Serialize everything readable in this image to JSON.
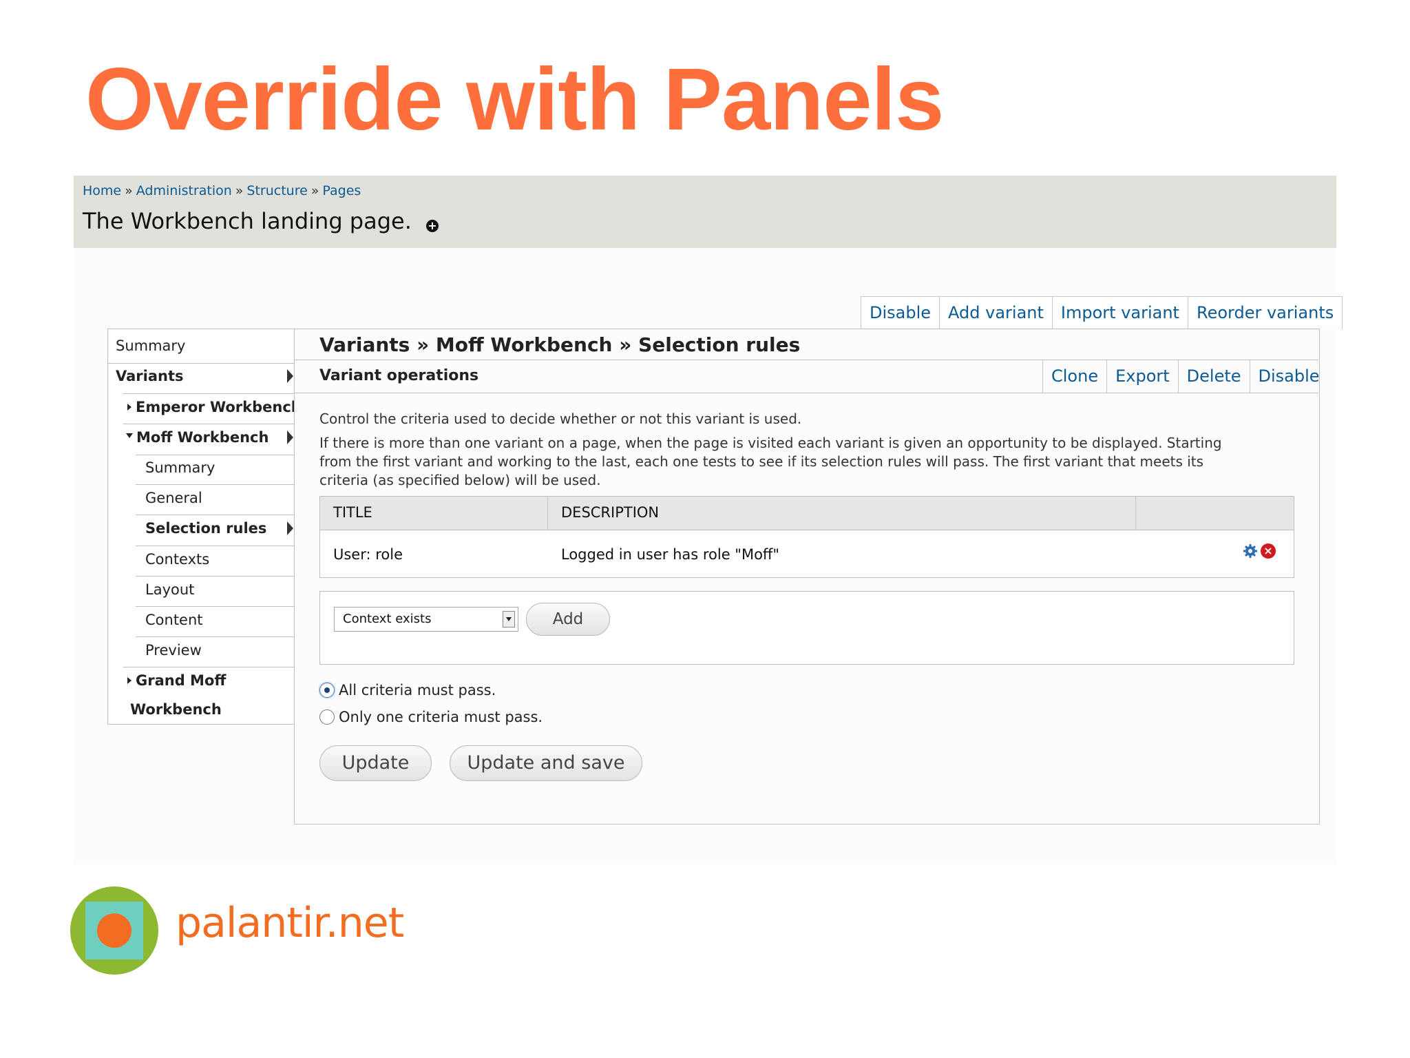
{
  "slide": {
    "title": "Override with Panels"
  },
  "header": {
    "breadcrumb": [
      "Home",
      "Administration",
      "Structure",
      "Pages"
    ],
    "breadcrumb_sep": "»",
    "page_title": "The Workbench landing page."
  },
  "top_actions": [
    "Disable",
    "Add variant",
    "Import variant",
    "Reorder variants"
  ],
  "leftnav": {
    "summary": "Summary",
    "variants": "Variants",
    "emperor": "Emperor Workbench",
    "moff": "Moff Workbench",
    "moff_items": [
      "Summary",
      "General",
      "Selection rules",
      "Contexts",
      "Layout",
      "Content",
      "Preview"
    ],
    "grand_moff_line1": "Grand Moff",
    "grand_moff_line2": "Workbench"
  },
  "main": {
    "heading": "Variants » Moff Workbench » Selection rules",
    "ops_label": "Variant operations",
    "ops_actions": [
      "Clone",
      "Export",
      "Delete",
      "Disable"
    ],
    "desc1": "Control the criteria used to decide whether or not this variant is used.",
    "desc2_lines": [
      "If there is more than one variant on a page, when the page is visited each variant is given an opportunity to be displayed. Starting",
      "from the first variant and working to the last, each one tests to see if its selection rules will pass. The first variant that meets its",
      "criteria (as specified below) will be used."
    ],
    "table": {
      "headers": [
        "TITLE",
        "DESCRIPTION"
      ],
      "rows": [
        {
          "title": "User: role",
          "description": "Logged in user has role \"Moff\""
        }
      ]
    },
    "add_select_value": "Context exists",
    "add_button": "Add",
    "radios": [
      {
        "label": "All criteria must pass.",
        "checked": true
      },
      {
        "label": "Only one criteria must pass.",
        "checked": false
      }
    ],
    "update_button": "Update",
    "update_save_button": "Update and save"
  },
  "logo": {
    "text": "palantir.net",
    "colors": {
      "ring": "#8db832",
      "square": "#6fcfbf",
      "dot": "#f26d21"
    }
  },
  "colors": {
    "title": "#ff6f3c",
    "link": "#0b5a93"
  },
  "icons": {
    "add_circle": "plus-circle-icon",
    "config": "gear-icon",
    "remove": "remove-icon"
  }
}
